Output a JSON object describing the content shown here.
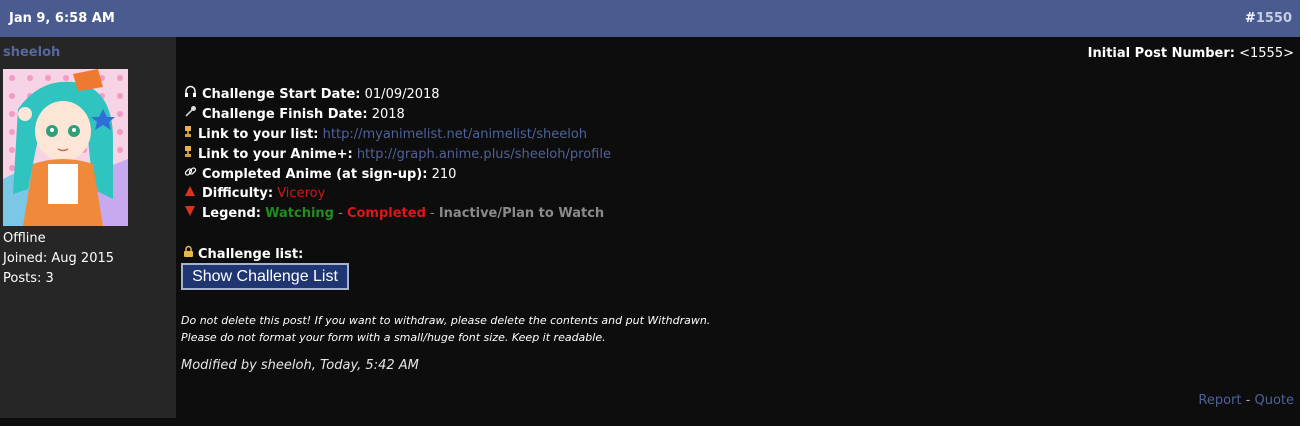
{
  "header": {
    "date": "Jan 9, 6:58 AM",
    "post_hash": "#",
    "post_number": "1550"
  },
  "sidebar": {
    "username": "sheeloh",
    "status": "Offline",
    "joined": "Joined: Aug 2015",
    "posts": "Posts: 3"
  },
  "post": {
    "initial_label": "Initial Post Number:",
    "initial_value": "<1555>",
    "start_label": "Challenge Start Date:",
    "start_value": "01/09/2018",
    "finish_label": "Challenge Finish Date:",
    "finish_value": "2018",
    "list_label": "Link to your list:",
    "list_url": "http://myanimelist.net/animelist/sheeloh",
    "animeplus_label": "Link to your Anime+:",
    "animeplus_url": "http://graph.anime.plus/sheeloh/profile",
    "completed_label": "Completed Anime (at sign-up):",
    "completed_value": "210",
    "difficulty_label": "Difficulty:",
    "difficulty_value": "Viceroy",
    "legend_label": "Legend:",
    "legend_watching": "Watching",
    "legend_sep1": " - ",
    "legend_completed": "Completed",
    "legend_sep2": " - ",
    "legend_inactive": "Inactive/Plan to Watch",
    "challenge_list_label": "Challenge list:",
    "show_button": "Show Challenge List",
    "note1": "Do not delete this post! If you want to withdraw, please delete the contents and put Withdrawn.",
    "note2": "Please do not format your form with a small/huge font size. Keep it readable.",
    "modified": "Modified by sheeloh, Today, 5:42 AM"
  },
  "footer": {
    "report": "Report",
    "dash": " - ",
    "quote": "Quote"
  },
  "icons": {
    "start": "headphones-icon",
    "finish": "microphone-icon",
    "list": "trophy-icon",
    "animeplus": "trophy-icon",
    "completed": "link-icon",
    "difficulty": "triangle-up-icon",
    "legend": "triangle-down-icon",
    "challenge_list": "lock-icon"
  }
}
